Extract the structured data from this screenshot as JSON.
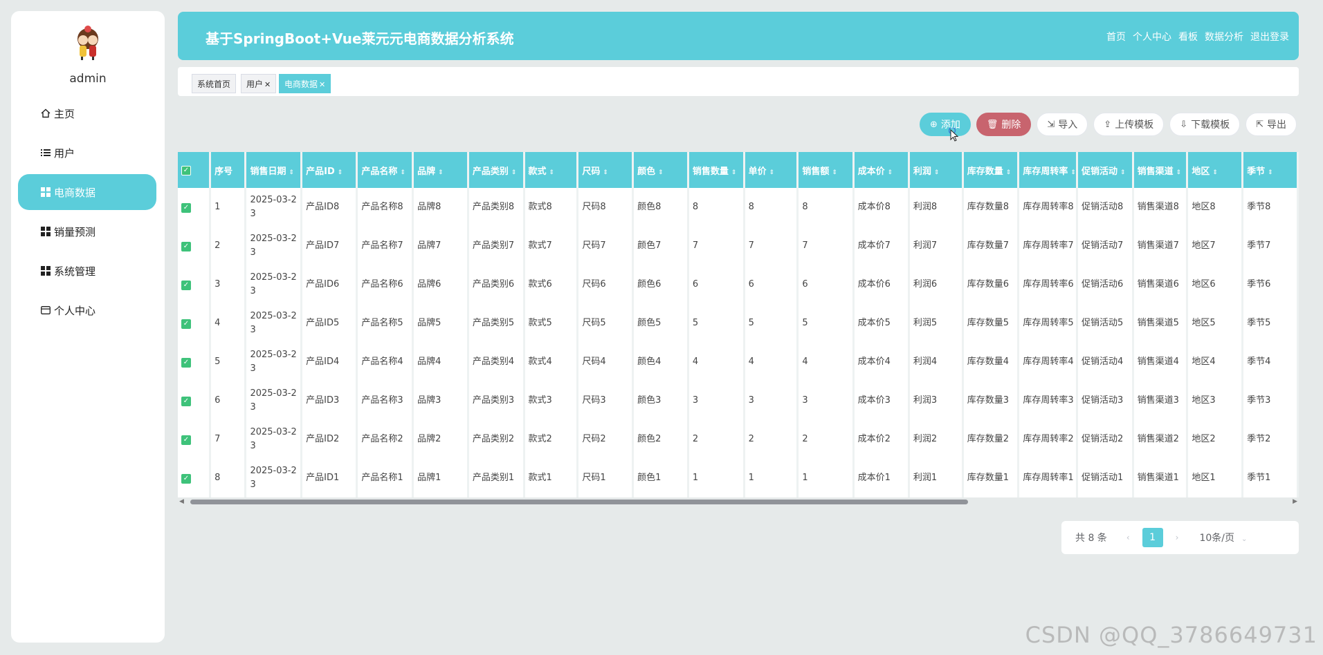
{
  "sidebar": {
    "username": "admin",
    "items": [
      {
        "label": "主页",
        "icon": "home-icon"
      },
      {
        "label": "用户",
        "icon": "list-icon"
      },
      {
        "label": "电商数据",
        "icon": "grid-icon",
        "active": true
      },
      {
        "label": "销量预测",
        "icon": "grid-icon"
      },
      {
        "label": "系统管理",
        "icon": "grid-icon"
      },
      {
        "label": "个人中心",
        "icon": "card-icon"
      }
    ]
  },
  "header": {
    "title": "基于SpringBoot+Vue莱元元电商数据分析系统",
    "nav": [
      "首页",
      "个人中心",
      "看板",
      "数据分析",
      "退出登录"
    ]
  },
  "tabs": [
    {
      "label": "系统首页",
      "closable": false
    },
    {
      "label": "用户",
      "closable": true
    },
    {
      "label": "电商数据",
      "closable": true,
      "active": true
    }
  ],
  "toolbar": {
    "add": "添加",
    "delete": "删除",
    "import": "导入",
    "upload_template": "上传模板",
    "download_template": "下载模板",
    "export": "导出"
  },
  "table": {
    "columns": [
      "序号",
      "销售日期",
      "产品ID",
      "产品名称",
      "品牌",
      "产品类别",
      "款式",
      "尺码",
      "颜色",
      "销售数量",
      "单价",
      "销售额",
      "成本价",
      "利润",
      "库存数量",
      "库存周转率",
      "促销活动",
      "销售渠道",
      "地区",
      "季节"
    ],
    "rows": [
      [
        "1",
        "2025-03-23",
        "产品ID8",
        "产品名称8",
        "品牌8",
        "产品类别8",
        "款式8",
        "尺码8",
        "颜色8",
        "8",
        "8",
        "8",
        "成本价8",
        "利润8",
        "库存数量8",
        "库存周转率8",
        "促销活动8",
        "销售渠道8",
        "地区8",
        "季节8"
      ],
      [
        "2",
        "2025-03-23",
        "产品ID7",
        "产品名称7",
        "品牌7",
        "产品类别7",
        "款式7",
        "尺码7",
        "颜色7",
        "7",
        "7",
        "7",
        "成本价7",
        "利润7",
        "库存数量7",
        "库存周转率7",
        "促销活动7",
        "销售渠道7",
        "地区7",
        "季节7"
      ],
      [
        "3",
        "2025-03-23",
        "产品ID6",
        "产品名称6",
        "品牌6",
        "产品类别6",
        "款式6",
        "尺码6",
        "颜色6",
        "6",
        "6",
        "6",
        "成本价6",
        "利润6",
        "库存数量6",
        "库存周转率6",
        "促销活动6",
        "销售渠道6",
        "地区6",
        "季节6"
      ],
      [
        "4",
        "2025-03-23",
        "产品ID5",
        "产品名称5",
        "品牌5",
        "产品类别5",
        "款式5",
        "尺码5",
        "颜色5",
        "5",
        "5",
        "5",
        "成本价5",
        "利润5",
        "库存数量5",
        "库存周转率5",
        "促销活动5",
        "销售渠道5",
        "地区5",
        "季节5"
      ],
      [
        "5",
        "2025-03-23",
        "产品ID4",
        "产品名称4",
        "品牌4",
        "产品类别4",
        "款式4",
        "尺码4",
        "颜色4",
        "4",
        "4",
        "4",
        "成本价4",
        "利润4",
        "库存数量4",
        "库存周转率4",
        "促销活动4",
        "销售渠道4",
        "地区4",
        "季节4"
      ],
      [
        "6",
        "2025-03-23",
        "产品ID3",
        "产品名称3",
        "品牌3",
        "产品类别3",
        "款式3",
        "尺码3",
        "颜色3",
        "3",
        "3",
        "3",
        "成本价3",
        "利润3",
        "库存数量3",
        "库存周转率3",
        "促销活动3",
        "销售渠道3",
        "地区3",
        "季节3"
      ],
      [
        "7",
        "2025-03-23",
        "产品ID2",
        "产品名称2",
        "品牌2",
        "产品类别2",
        "款式2",
        "尺码2",
        "颜色2",
        "2",
        "2",
        "2",
        "成本价2",
        "利润2",
        "库存数量2",
        "库存周转率2",
        "促销活动2",
        "销售渠道2",
        "地区2",
        "季节2"
      ],
      [
        "8",
        "2025-03-23",
        "产品ID1",
        "产品名称1",
        "品牌1",
        "产品类别1",
        "款式1",
        "尺码1",
        "颜色1",
        "1",
        "1",
        "1",
        "成本价1",
        "利润1",
        "库存数量1",
        "库存周转率1",
        "促销活动1",
        "销售渠道1",
        "地区1",
        "季节1"
      ]
    ]
  },
  "pagination": {
    "total": "共 8 条",
    "current_page": "1",
    "page_size": "10条/页"
  },
  "watermark": "CSDN @QQ_3786649731",
  "colors": {
    "accent": "#5bcdda",
    "danger": "#c8646e",
    "checkbox": "#3ec27a"
  }
}
